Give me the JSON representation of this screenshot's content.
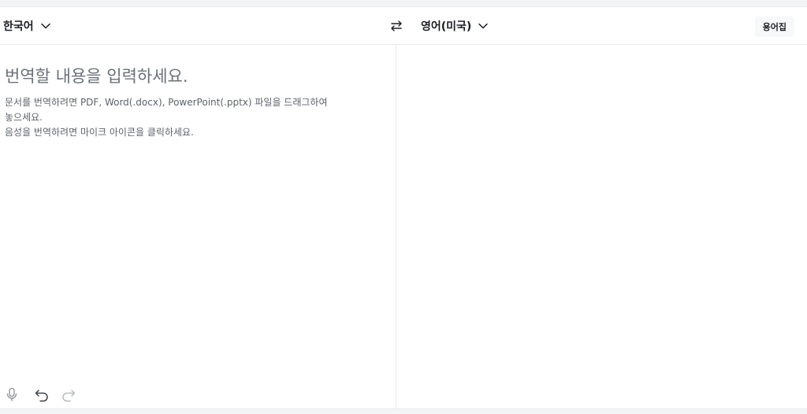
{
  "header": {
    "source_language": "한국어",
    "target_language": "영어(미국)",
    "glossary_label": "용어집"
  },
  "source": {
    "placeholder": "번역할 내용을 입력하세요.",
    "hint_lines": [
      "문서를 번역하려면 PDF, Word(.docx), PowerPoint(.pptx) 파일을 드래그하여",
      "놓으세요.",
      "음성을 번역하려면 마이크 아이콘을 클릭하세요."
    ]
  },
  "icons": {
    "source_dropdown": "chevron-down-icon",
    "target_dropdown": "chevron-down-icon",
    "swap": "swap-arrows-icon",
    "mic": "microphone-icon",
    "undo": "undo-icon",
    "redo": "redo-icon"
  },
  "colors": {
    "text": "#1b1e25",
    "placeholder": "#6a7079",
    "icon": "#5d636b",
    "icon_disabled": "#b7bcc2",
    "border": "#e8eaed"
  }
}
